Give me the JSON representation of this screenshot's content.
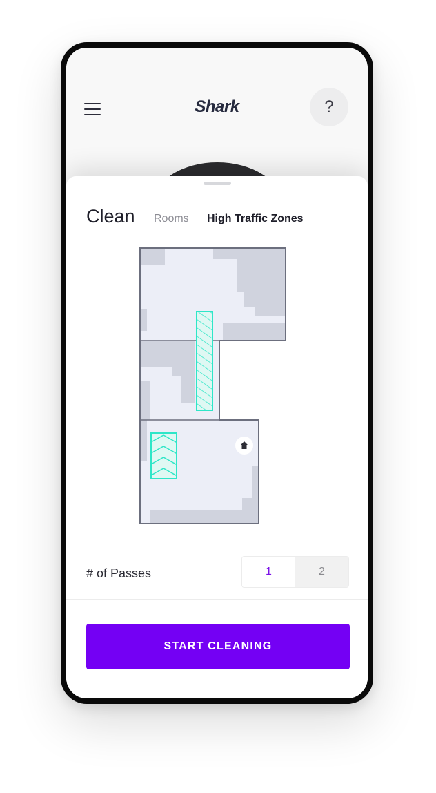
{
  "header": {
    "logo_text": "Shark",
    "help_label": "?"
  },
  "tabs": {
    "clean": "Clean",
    "rooms": "Rooms",
    "high_traffic_zones": "High Traffic Zones"
  },
  "passes": {
    "label": "# of Passes",
    "options": [
      "1",
      "2"
    ],
    "selected": "1"
  },
  "actions": {
    "start_label": "START CLEANING"
  },
  "colors": {
    "accent": "#7400f4",
    "zone": "#2ee6c8",
    "map_floor": "#eceef7",
    "map_obstacle": "#d0d3de",
    "map_wall": "#6c6f7e"
  },
  "icons": {
    "menu": "hamburger-menu-icon",
    "help": "question-mark-icon",
    "dock": "home-dock-icon"
  }
}
